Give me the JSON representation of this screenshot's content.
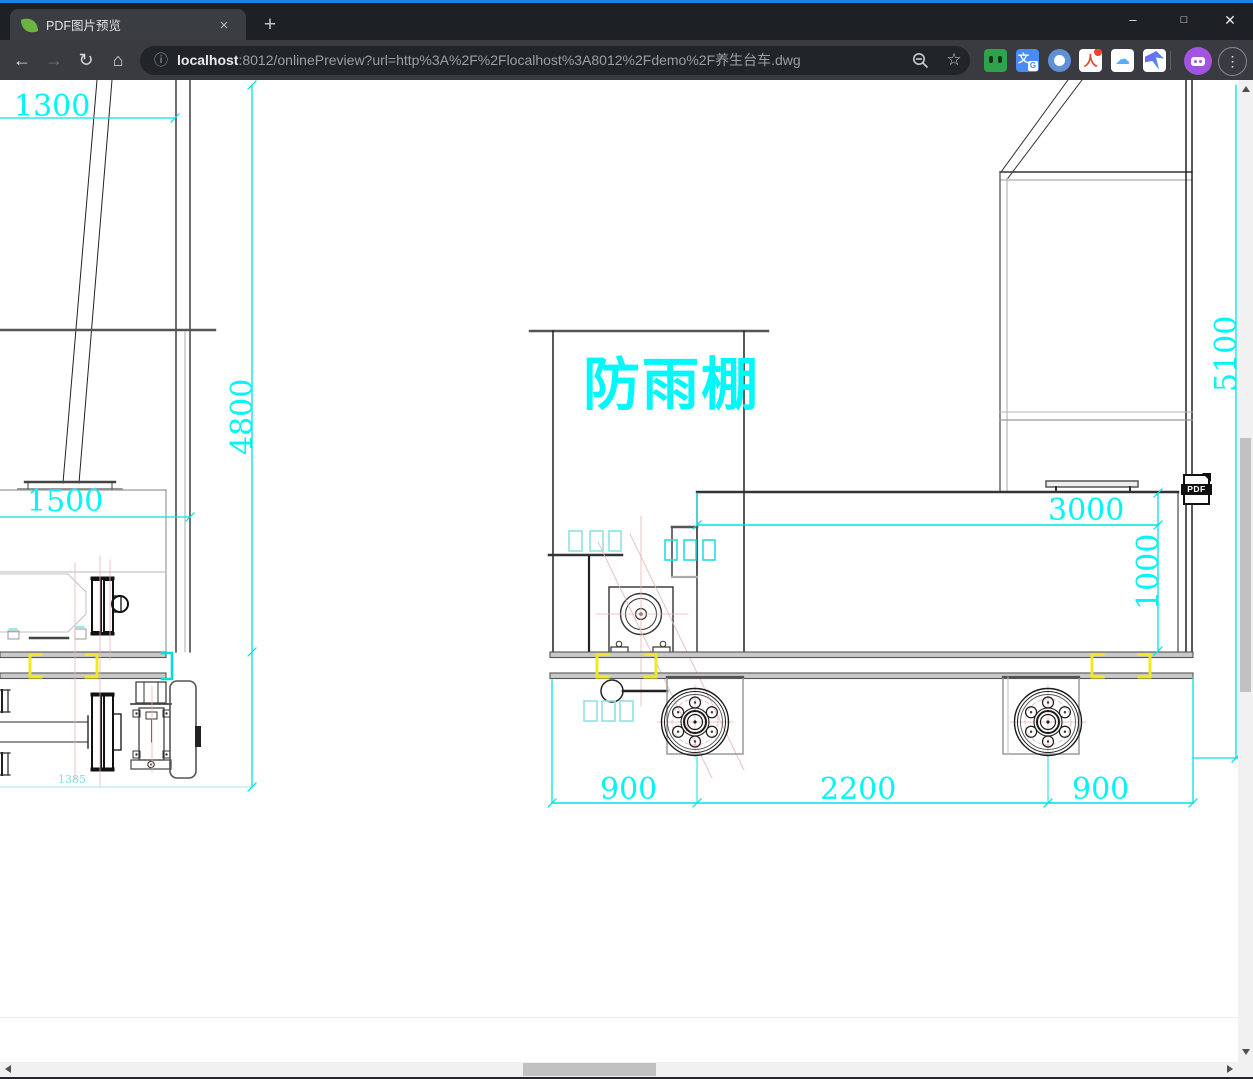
{
  "browser": {
    "tab_title": "PDF图片预览",
    "url_host": "localhost",
    "url_rest": ":8012/onlinePreview?url=http%3A%2F%2Flocalhost%3A8012%2Fdemo%2F养生台车.dwg",
    "icons": {
      "back": "←",
      "forward": "→",
      "reload": "↻",
      "home": "⌂",
      "info": "ⓘ",
      "star": "☆",
      "menu": "⋮",
      "tab_close": "×",
      "new_tab": "+",
      "win_min": "–",
      "win_max": "□",
      "win_close": "✕",
      "cloud": "☁",
      "person": "人",
      "translate_zh": "文",
      "translate_g": "G"
    },
    "extensions": [
      "tampermonkey",
      "google-translate",
      "blue-ring",
      "person-badge",
      "cloud",
      "bird"
    ],
    "accent_color": "#1b84e8",
    "avatar_color": "#a254e0"
  },
  "viewer": {
    "pdf_badge": "PDF",
    "shelter_label": "防雨棚",
    "dimensions": {
      "d1300": "1300",
      "d4800": "4800",
      "d1500": "1500",
      "d1385": "1385",
      "d5100": "5100",
      "d3000": "3000",
      "d1000": "1000",
      "d900_left": "900",
      "d2200": "2200",
      "d900_right": "900"
    },
    "colors": {
      "dimension_text": "#00f6f6",
      "dimension_line": "#00e2e2",
      "highlight_yellow": "#f0e822",
      "centerline_pink": "#e8b4b4"
    }
  }
}
